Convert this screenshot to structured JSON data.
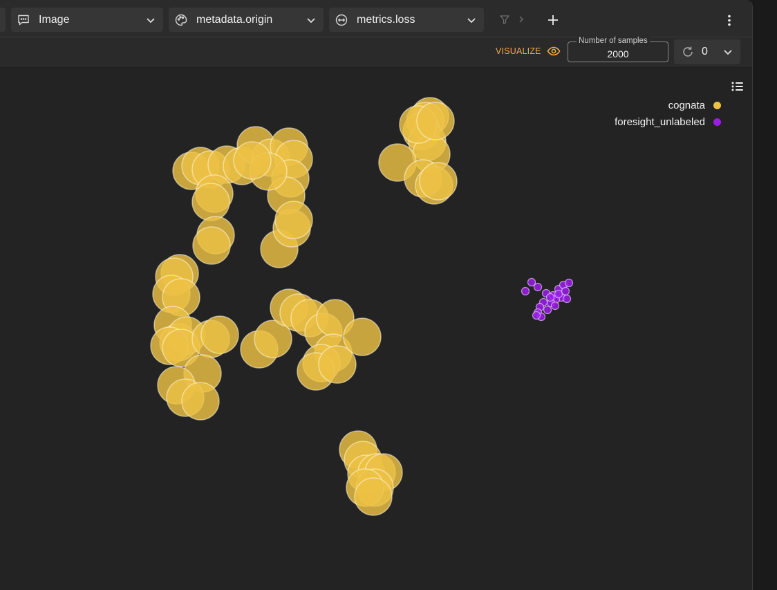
{
  "toolbar": {
    "label_field": {
      "label": "Image",
      "icon": "comment-icon"
    },
    "color_field": {
      "label": "metadata.origin",
      "icon": "palette-icon"
    },
    "size_field": {
      "label": "metrics.loss",
      "icon": "resize-icon"
    }
  },
  "subbar": {
    "visualize_label": "VISUALIZE",
    "samples_label": "Number of samples",
    "samples_value": "2000",
    "refresh_value": "0"
  },
  "legend": [
    {
      "label": "cognata",
      "color": "#ecc144"
    },
    {
      "label": "foresight_unlabeled",
      "color": "#9b1ce6"
    }
  ],
  "chart_data": {
    "type": "scatter",
    "series": [
      {
        "name": "cognata",
        "color": "#ecc144"
      },
      {
        "name": "foresight_unlabeled",
        "color": "#9b1ce6"
      }
    ]
  }
}
